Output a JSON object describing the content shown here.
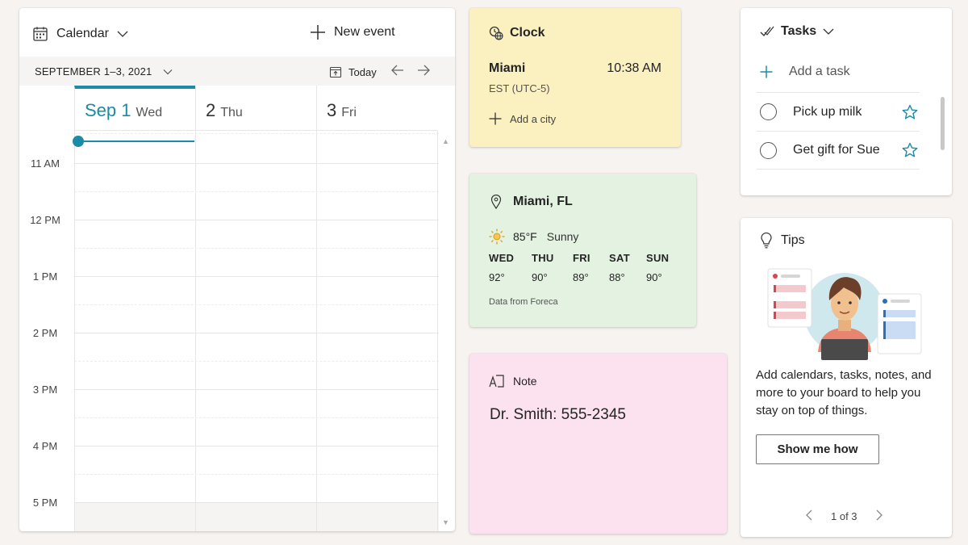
{
  "calendar": {
    "title": "Calendar",
    "new_event_label": "New event",
    "date_range": "SEPTEMBER 1–3, 2021",
    "today_label": "Today",
    "days": [
      {
        "num": "Sep 1",
        "name": "Wed"
      },
      {
        "num": "2",
        "name": "Thu"
      },
      {
        "num": "3",
        "name": "Fri"
      }
    ],
    "hours": [
      "11 AM",
      "12 PM",
      "1 PM",
      "2 PM",
      "3 PM",
      "4 PM",
      "5 PM"
    ],
    "accent_color": "#1a8ca5"
  },
  "clock": {
    "title": "Clock",
    "city": "Miami",
    "time": "10:38 AM",
    "timezone": "EST (UTC-5)",
    "add_city_label": "Add a city",
    "background": "#fbf0c0"
  },
  "weather": {
    "location": "Miami, FL",
    "current_temp": "85°F",
    "condition": "Sunny",
    "forecast": [
      {
        "day": "WED",
        "temp": "92°"
      },
      {
        "day": "THU",
        "temp": "90°"
      },
      {
        "day": "FRI",
        "temp": "89°"
      },
      {
        "day": "SAT",
        "temp": "88°"
      },
      {
        "day": "SUN",
        "temp": "90°"
      }
    ],
    "source": "Data from Foreca",
    "background": "#e3f2e1"
  },
  "note": {
    "title": "Note",
    "body": "Dr. Smith: 555-2345",
    "background": "#fce1ee"
  },
  "tasks": {
    "title": "Tasks",
    "add_placeholder": "Add a task",
    "items": [
      {
        "label": "Pick up milk"
      },
      {
        "label": "Get gift for Sue"
      }
    ]
  },
  "tips": {
    "title": "Tips",
    "text": "Add calendars, tasks, notes, and more to your board to help you stay on top of things.",
    "button_label": "Show me how",
    "pager": "1 of 3"
  },
  "icons": {
    "calendar": "calendar-icon",
    "plus": "plus-icon",
    "clock": "globe-clock-icon",
    "location": "location-pin-icon",
    "sun": "sun-icon",
    "note": "note-icon",
    "tasks": "checkmark-icon",
    "star": "star-icon",
    "tips": "lightbulb-icon"
  }
}
